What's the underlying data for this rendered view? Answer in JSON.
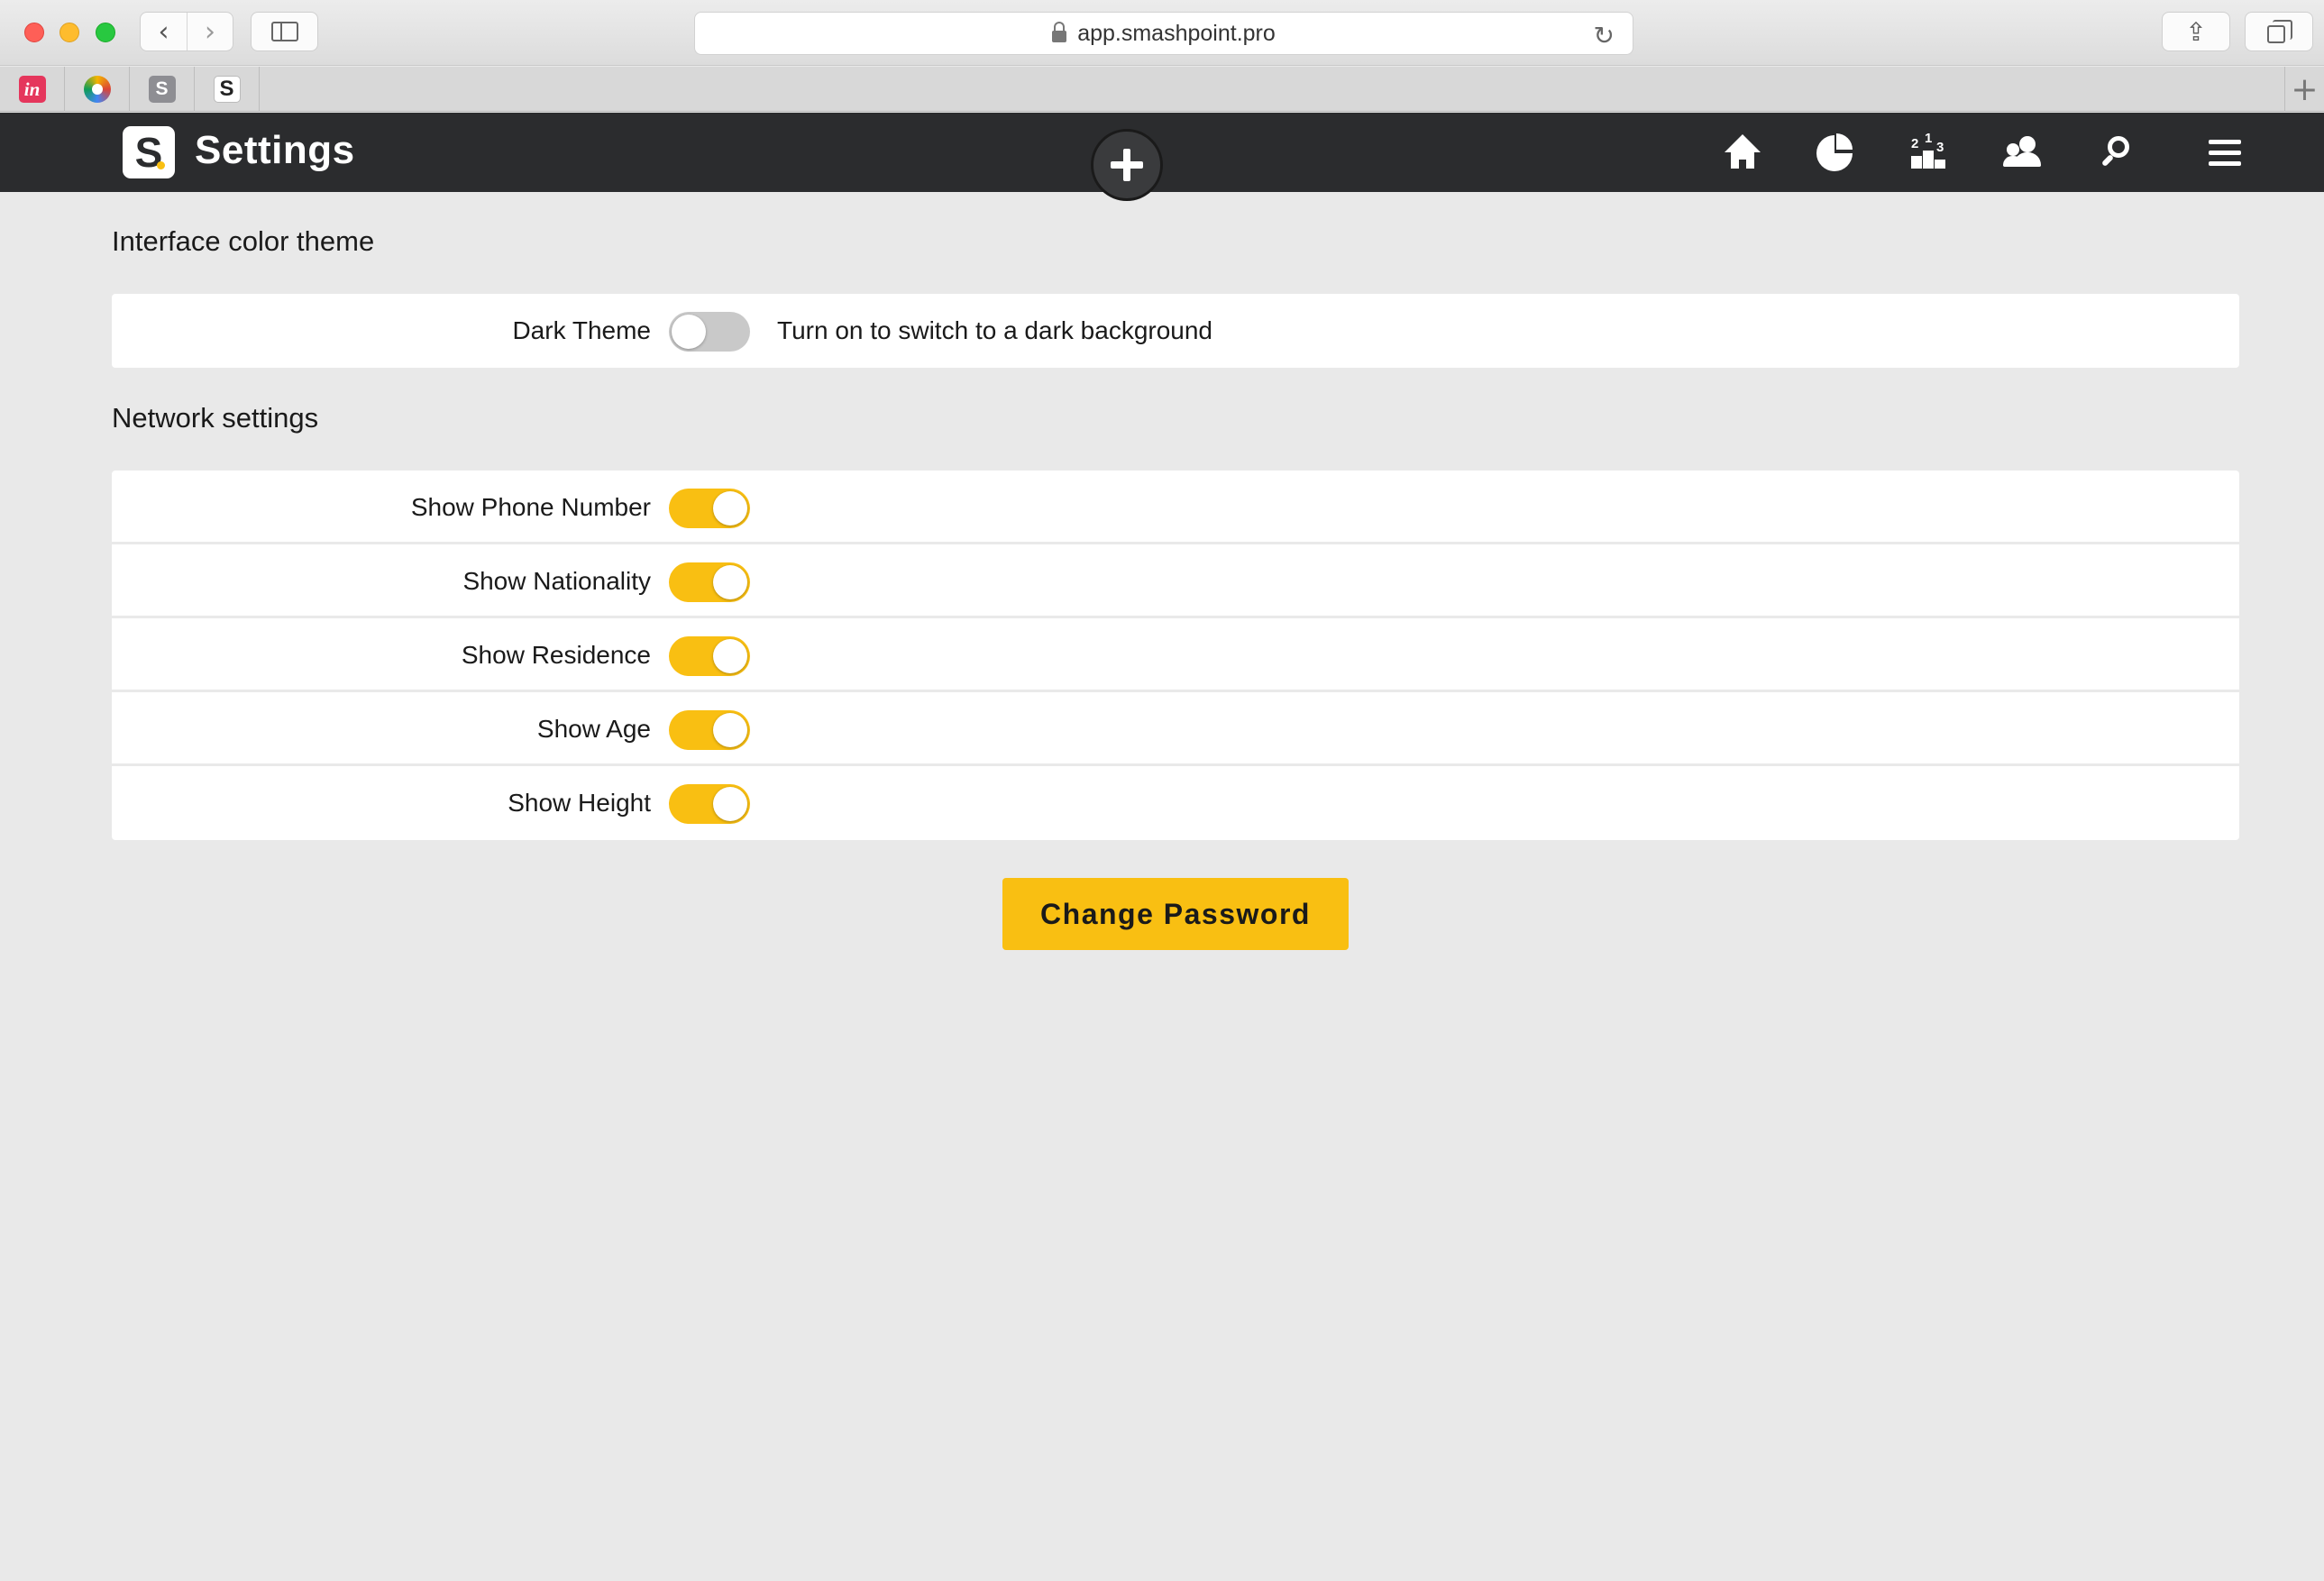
{
  "browser": {
    "url": "app.smashpoint.pro",
    "nav_back": "‹",
    "nav_forward": "›",
    "share_glyph": "⇪",
    "reload_glyph": "↻",
    "newtab_glyph": "+",
    "favorites": [
      {
        "name": "invision",
        "label": "in"
      },
      {
        "name": "colors",
        "label": ""
      },
      {
        "name": "s-gray",
        "label": "S"
      },
      {
        "name": "smashpoint",
        "label": "S"
      }
    ]
  },
  "header": {
    "logo_letter": "S",
    "title": "Settings",
    "accent_color": "#f9bf12",
    "bar_color": "#2b2c2e",
    "rank_digits": [
      "1",
      "2",
      "3"
    ],
    "icons": [
      "home-icon",
      "stats-icon",
      "ranking-icon",
      "people-icon",
      "search-icon",
      "menu-icon"
    ]
  },
  "interface_section": {
    "title": "Interface color theme",
    "rows": [
      {
        "label": "Dark Theme",
        "enabled": false,
        "description": "Turn on to switch to a dark background"
      }
    ]
  },
  "network_section": {
    "title": "Network settings",
    "rows": [
      {
        "label": "Show Phone Number",
        "enabled": true
      },
      {
        "label": "Show Nationality",
        "enabled": true
      },
      {
        "label": "Show Residence",
        "enabled": true
      },
      {
        "label": "Show Age",
        "enabled": true
      },
      {
        "label": "Show Height",
        "enabled": true
      }
    ]
  },
  "actions": {
    "change_password_label": "Change Password"
  }
}
